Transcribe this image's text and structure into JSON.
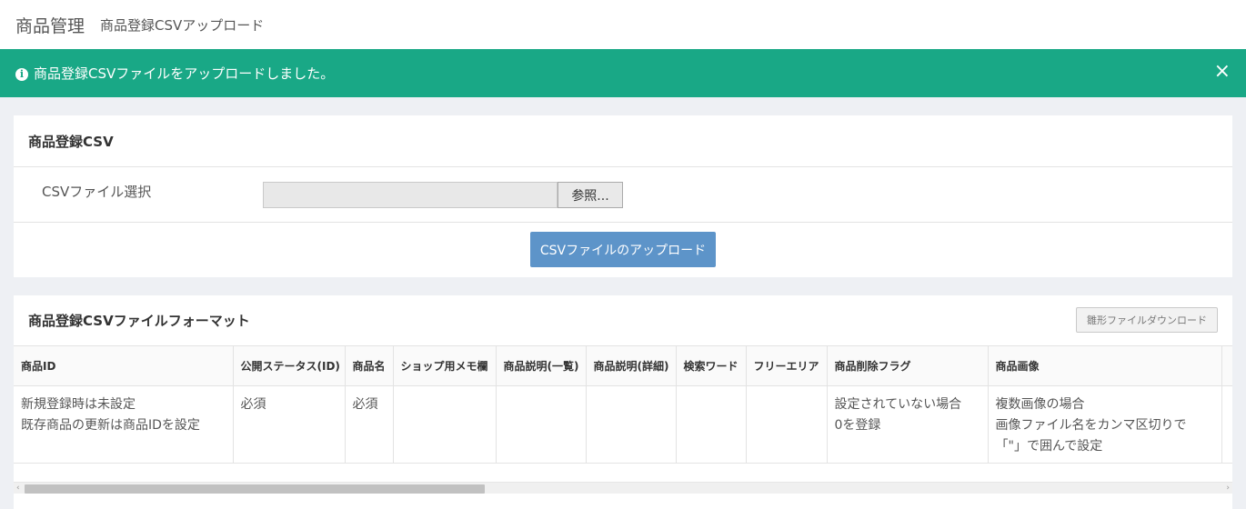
{
  "header": {
    "title": "商品管理",
    "subtitle": "商品登録CSVアップロード"
  },
  "alert": {
    "icon": "info-icon",
    "message": "商品登録CSVファイルをアップロードしました。",
    "close": "×",
    "color": "#19a886"
  },
  "upload_card": {
    "title": "商品登録CSV",
    "file_label": "CSVファイル選択",
    "file_value": "",
    "browse_label": "参照...",
    "upload_label": "CSVファイルのアップロード",
    "upload_color": "#5d94c9"
  },
  "format_card": {
    "title": "商品登録CSVファイルフォーマット",
    "download_label": "雛形ファイルダウンロード",
    "columns": [
      {
        "header": "商品ID",
        "lines": [
          "新規登録時は未設定",
          "既存商品の更新は商品IDを設定"
        ]
      },
      {
        "header": "公開ステータス(ID)",
        "lines": [
          "必須"
        ]
      },
      {
        "header": "商品名",
        "lines": [
          "必須"
        ]
      },
      {
        "header": "ショップ用メモ欄",
        "lines": []
      },
      {
        "header": "商品説明(一覧)",
        "lines": []
      },
      {
        "header": "商品説明(詳細)",
        "lines": []
      },
      {
        "header": "検索ワード",
        "lines": []
      },
      {
        "header": "フリーエリア",
        "lines": []
      },
      {
        "header": "商品削除フラグ",
        "lines": [
          "設定されていない場合",
          "0を登録"
        ]
      },
      {
        "header": "商品画像",
        "lines": [
          "複数画像の場合",
          "画像ファイル名をカンマ区切りで",
          "「\"」で囲んで設定"
        ]
      }
    ]
  }
}
